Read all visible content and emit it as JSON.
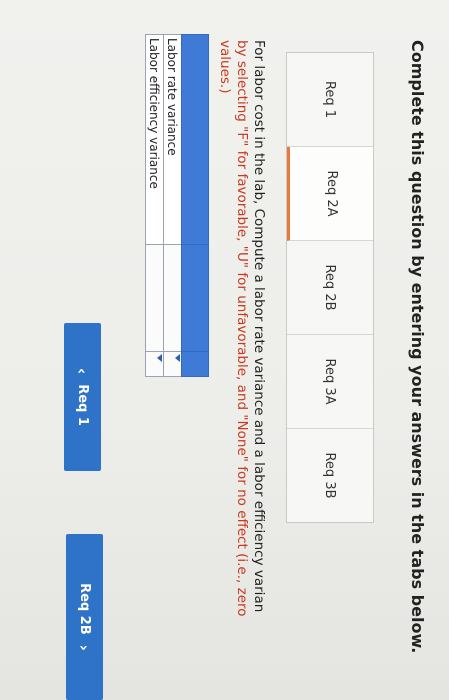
{
  "title": "Complete this question by entering your answers in the tabs below.",
  "tabs": [
    {
      "label": "Req 1"
    },
    {
      "label": "Req 2A"
    },
    {
      "label": "Req 2B"
    },
    {
      "label": "Req 3A"
    },
    {
      "label": "Req 3B"
    }
  ],
  "active_tab": "Req 2A",
  "instructions": {
    "part1": "For labor cost in the lab, Compute a labor rate variance and a labor efficiency varian",
    "part2": "by selecting \"F\" for favorable, \"U\" for unfavorable, and \"None\" for no effect (i.e., zero",
    "part3": "values.)"
  },
  "table": {
    "rows": [
      {
        "label": "Labor rate variance",
        "amount": "",
        "effect": ""
      },
      {
        "label": "Labor efficiency variance",
        "amount": "",
        "effect": ""
      }
    ]
  },
  "nav": {
    "prev_label": "Req 1",
    "next_label": "Req 2B",
    "prev_icon": "chevron-left-icon",
    "next_icon": "chevron-right-icon"
  },
  "colors": {
    "accent": "#2f73c8",
    "table_header": "#3f7ad6",
    "instruction_red": "#c83b1e",
    "active_tab_underline": "#e8793a"
  }
}
